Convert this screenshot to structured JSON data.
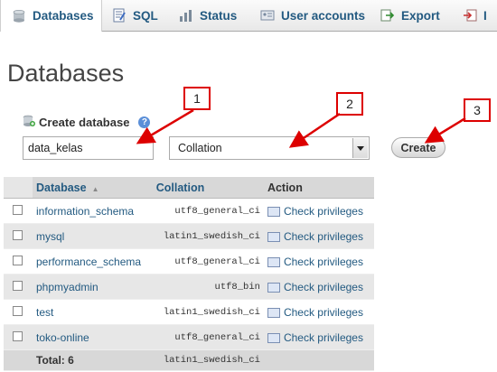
{
  "tabs": [
    {
      "label": "Databases",
      "icon": "database-icon",
      "active": true
    },
    {
      "label": "SQL",
      "icon": "sql-icon",
      "active": false
    },
    {
      "label": "Status",
      "icon": "status-icon",
      "active": false
    },
    {
      "label": "User accounts",
      "icon": "user-accounts-icon",
      "active": false
    },
    {
      "label": "Export",
      "icon": "export-icon",
      "active": false
    },
    {
      "label": "I",
      "icon": "import-icon",
      "active": false
    }
  ],
  "page_title": "Databases",
  "create": {
    "label": "Create database",
    "db_name_value": "data_kelas",
    "collation_selected": "Collation",
    "button_label": "Create"
  },
  "callouts": [
    "1",
    "2",
    "3"
  ],
  "table": {
    "headers": [
      "Database",
      "Collation",
      "Action"
    ],
    "rows": [
      {
        "name": "information_schema",
        "collation": "utf8_general_ci",
        "action": "Check privileges"
      },
      {
        "name": "mysql",
        "collation": "latin1_swedish_ci",
        "action": "Check privileges"
      },
      {
        "name": "performance_schema",
        "collation": "utf8_general_ci",
        "action": "Check privileges"
      },
      {
        "name": "phpmyadmin",
        "collation": "utf8_bin",
        "action": "Check privileges"
      },
      {
        "name": "test",
        "collation": "latin1_swedish_ci",
        "action": "Check privileges"
      },
      {
        "name": "toko-online",
        "collation": "utf8_general_ci",
        "action": "Check privileges"
      }
    ],
    "total_label": "Total: 6",
    "total_collation": "latin1_swedish_ci"
  },
  "colors": {
    "link": "#235a81",
    "callout_border": "#dd0000",
    "arrow": "#dd0000"
  }
}
